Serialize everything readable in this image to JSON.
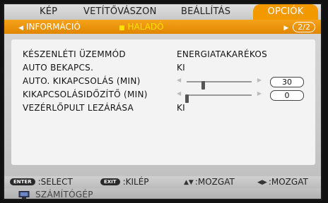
{
  "tabs": {
    "kep": "KÉP",
    "vetitovaszon": "VETÍTŐVÁSZON",
    "beallitas": "BEÁLLÍTÁS",
    "opciok": "OPCIÓK"
  },
  "subtabs": {
    "informacio": "INFORMÁCIÓ",
    "halado": "HALADÓ",
    "page": "2/2"
  },
  "rows": [
    {
      "label": "KÉSZENLÉTI ÜZEMMÓD",
      "value": "ENERGIATAKARÉKOS"
    },
    {
      "label": "AUTO BEKAPCS.",
      "value": "KI"
    },
    {
      "label": "AUTO. KIKAPCSOLÁS (MIN)",
      "number": "30",
      "level": 0.25
    },
    {
      "label": "KIKAPCSOLÁSIDŐZÍTŐ (MIN)",
      "number": "0",
      "level": 0.0
    },
    {
      "label": "VEZÉRLŐPULT LEZÁRÁSA",
      "value": "KI"
    }
  ],
  "help": {
    "enter_key": "ENTER",
    "select": ":SELECT",
    "exit_key": "EXIT",
    "exit": ":KILÉP",
    "move_v": ":MOZGAT",
    "move_h": ":MOZGAT"
  },
  "source": "SZÁMÍTÓGÉP",
  "colors": {
    "accent": "#f29900",
    "selected": "#ffe200"
  },
  "icons": {
    "slider_left": "triangle-left",
    "slider_right": "triangle-right",
    "source": "monitor-icon"
  }
}
